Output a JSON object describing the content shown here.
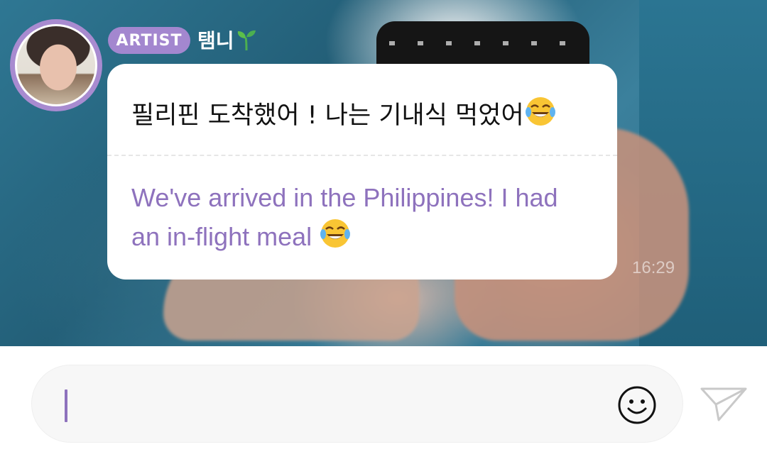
{
  "sender": {
    "badge": "ARTIST",
    "name": "탬니",
    "name_emoji": "sprout-icon"
  },
  "message": {
    "original": "필리핀 도착했어 ! 나는 기내식 먹었어",
    "translation": "We've arrived in the Philippines! I had an in-flight meal",
    "emoji": "face-with-tears-of-joy-icon",
    "time": "16:29"
  },
  "composer": {
    "value": "",
    "emoji_button": "smiley-icon",
    "send_button": "send-icon"
  },
  "colors": {
    "accent": "#a387cf",
    "translation_text": "#8e72bd",
    "bubble": "#ffffff",
    "input_bg": "#f7f7f7"
  }
}
